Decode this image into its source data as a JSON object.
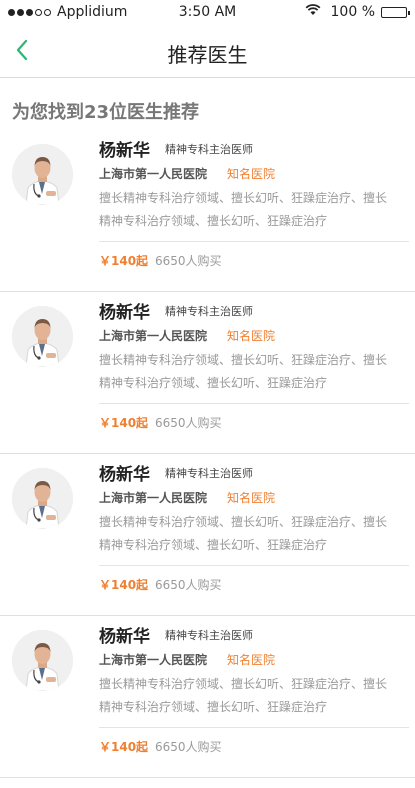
{
  "status_bar": {
    "carrier": "Applidium",
    "time": "3:50 AM",
    "battery": "100 %",
    "battery_level": 1.0
  },
  "nav": {
    "title": "推荐医生"
  },
  "summary": "为您找到23位医生推荐",
  "colors": {
    "accent_green": "#2bb673",
    "accent_orange": "#f08030"
  },
  "doctors": [
    {
      "name": "杨新华",
      "title": "精神专科主治医师",
      "hospital": "上海市第一人民医院",
      "badge": "知名医院",
      "specialty": "擅长精神专科治疗领域、擅长幻听、狂躁症治疗、擅长精神专科治疗领域、擅长幻听、狂躁症治疗",
      "price": "￥140起",
      "buyers": "6650人购买"
    },
    {
      "name": "杨新华",
      "title": "精神专科主治医师",
      "hospital": "上海市第一人民医院",
      "badge": "知名医院",
      "specialty": "擅长精神专科治疗领域、擅长幻听、狂躁症治疗、擅长精神专科治疗领域、擅长幻听、狂躁症治疗",
      "price": "￥140起",
      "buyers": "6650人购买"
    },
    {
      "name": "杨新华",
      "title": "精神专科主治医师",
      "hospital": "上海市第一人民医院",
      "badge": "知名医院",
      "specialty": "擅长精神专科治疗领域、擅长幻听、狂躁症治疗、擅长精神专科治疗领域、擅长幻听、狂躁症治疗",
      "price": "￥140起",
      "buyers": "6650人购买"
    },
    {
      "name": "杨新华",
      "title": "精神专科主治医师",
      "hospital": "上海市第一人民医院",
      "badge": "知名医院",
      "specialty": "擅长精神专科治疗领域、擅长幻听、狂躁症治疗、擅长精神专科治疗领域、擅长幻听、狂躁症治疗",
      "price": "￥140起",
      "buyers": "6650人购买"
    }
  ]
}
